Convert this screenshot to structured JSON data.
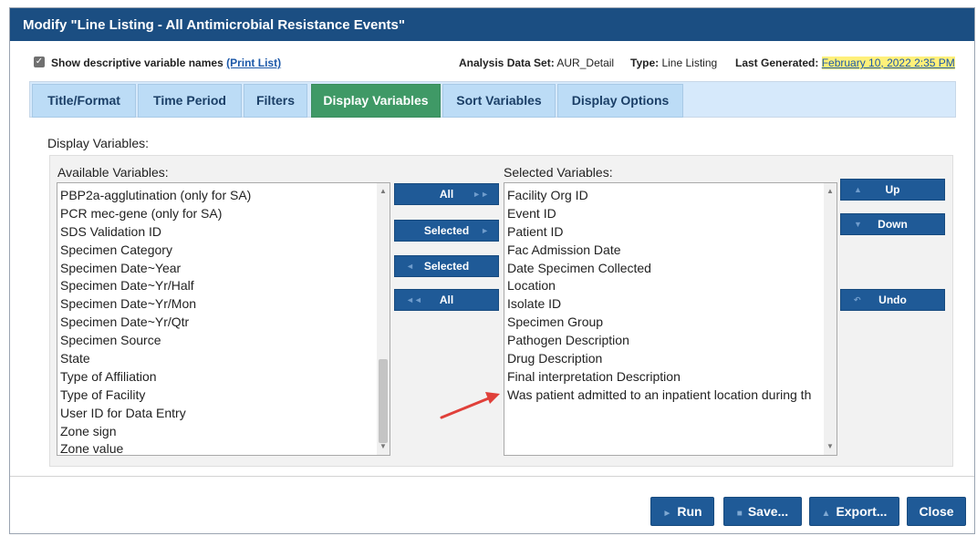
{
  "dialog": {
    "title": "Modify \"Line Listing - All Antimicrobial Resistance Events\""
  },
  "infobar": {
    "show_descriptive_label": "Show descriptive variable names",
    "print_list_link": "(Print List)",
    "dataset_label": "Analysis Data Set:",
    "dataset_value": "AUR_Detail",
    "type_label": "Type:",
    "type_value": "Line Listing",
    "generated_label": "Last Generated:",
    "generated_value": "February 10, 2022 2:35 PM"
  },
  "tabs": [
    {
      "label": "Title/Format",
      "active": false
    },
    {
      "label": "Time Period",
      "active": false
    },
    {
      "label": "Filters",
      "active": false
    },
    {
      "label": "Display Variables",
      "active": true
    },
    {
      "label": "Sort Variables",
      "active": false
    },
    {
      "label": "Display Options",
      "active": false
    }
  ],
  "panel": {
    "heading": "Display Variables:",
    "available_label": "Available Variables:",
    "selected_label": "Selected Variables:",
    "available_items": [
      "PBP2a-agglutination (only for SA)",
      "PCR mec-gene (only for SA)",
      "SDS Validation ID",
      "Specimen Category",
      "Specimen Date~Year",
      "Specimen Date~Yr/Half",
      "Specimen Date~Yr/Mon",
      "Specimen Date~Yr/Qtr",
      "Specimen Source",
      "State",
      "Type of Affiliation",
      "Type of Facility",
      "User ID for Data Entry",
      "Zone sign",
      "Zone value"
    ],
    "selected_items": [
      "Facility Org ID",
      "Event ID",
      "Patient ID",
      "Fac Admission Date",
      "Date Specimen Collected",
      "Location",
      "Isolate ID",
      "Specimen Group",
      "Pathogen Description",
      "Drug Description",
      "Final interpretation Description",
      "Was patient admitted to an inpatient location during th"
    ],
    "move_buttons": {
      "add_all": "All",
      "add_selected": "Selected",
      "remove_selected": "Selected",
      "remove_all": "All"
    },
    "order_buttons": {
      "up": "Up",
      "down": "Down",
      "undo": "Undo"
    }
  },
  "footer": {
    "run": "Run",
    "save": "Save...",
    "export": "Export...",
    "close": "Close"
  },
  "colors": {
    "titlebar": "#1b4e82",
    "active_tab": "#3f9966",
    "button": "#1f5a97",
    "arrow": "#e0403a",
    "highlight": "#fff07a"
  }
}
